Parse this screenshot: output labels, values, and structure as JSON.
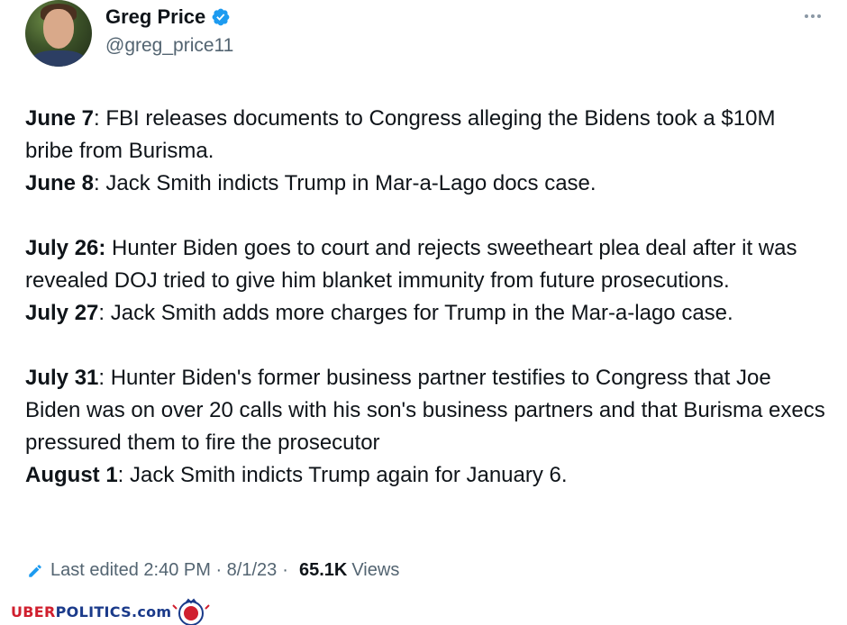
{
  "author": {
    "name": "Greg Price",
    "handle": "@greg_price11",
    "verified": true,
    "badge_color": "#1d9bf0"
  },
  "tweet": {
    "entries": [
      {
        "date": "June 7",
        "text": ": FBI releases documents to Congress alleging the Bidens took a $10M bribe from Burisma."
      },
      {
        "date": "June 8",
        "text": ": Jack Smith indicts Trump in Mar-a-Lago docs case."
      },
      {
        "date": "July 26:",
        "text": " Hunter Biden goes to court and rejects sweetheart plea deal after it was revealed DOJ tried to give him blanket immunity from future prosecutions."
      },
      {
        "date": "July 27",
        "text": ": Jack Smith adds more charges for Trump in the Mar-a-lago case."
      },
      {
        "date": "July 31",
        "text": ": Hunter Biden's former business partner testifies to Congress that Joe Biden was on over 20 calls with his son's business partners and that Burisma execs pressured them to fire the prosecutor"
      },
      {
        "date": "August 1",
        "text": ": Jack Smith indicts Trump again for January 6."
      }
    ]
  },
  "meta": {
    "edited_label": "Last edited 2:40 PM · 8/1/23",
    "separator": "·",
    "views_count": "65.1K",
    "views_label": "Views"
  },
  "watermark": {
    "part1": "UBER",
    "part2": "POLITICS.com",
    "color1": "#d01f2e",
    "color2": "#1a3a8a"
  },
  "icons": [
    "verified-badge-icon",
    "more-options-icon",
    "edit-pencil-icon",
    "uberpolitics-logo"
  ]
}
